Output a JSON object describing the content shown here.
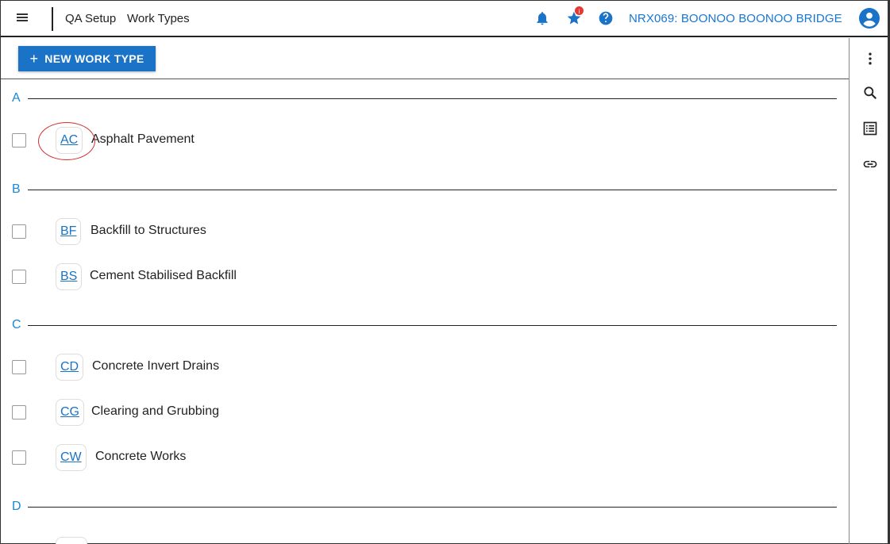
{
  "header": {
    "breadcrumb": [
      "QA Setup",
      "Work Types"
    ],
    "project": "NRX069: BOONOO BOONOO BRIDGE",
    "star_badge": "i"
  },
  "toolbar": {
    "new_button": "NEW WORK TYPE",
    "new_button_plus": "+"
  },
  "sections": [
    {
      "letter": "A",
      "items": [
        {
          "code": "AC",
          "label": "Asphalt Pavement"
        }
      ]
    },
    {
      "letter": "B",
      "items": [
        {
          "code": "BF",
          "label": "Backfill to Structures"
        },
        {
          "code": "BS",
          "label": "Cement Stabilised Backfill"
        }
      ]
    },
    {
      "letter": "C",
      "items": [
        {
          "code": "CD",
          "label": "Concrete Invert Drains"
        },
        {
          "code": "CG",
          "label": "Clearing and Grubbing"
        },
        {
          "code": "CW",
          "label": "Concrete Works"
        }
      ]
    },
    {
      "letter": "D",
      "items": []
    }
  ],
  "colors": {
    "accent": "#1a73c6",
    "link": "#1a88d8",
    "annotation": "#d32f2f"
  }
}
